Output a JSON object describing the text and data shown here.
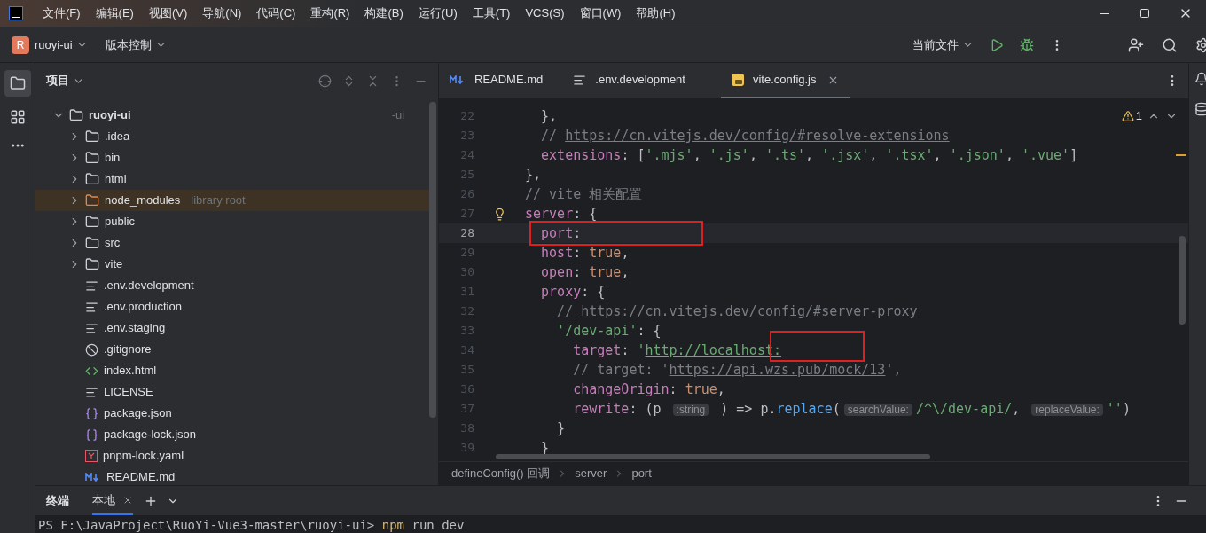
{
  "menu_bar": {
    "items": [
      "文件(F)",
      "编辑(E)",
      "视图(V)",
      "导航(N)",
      "代码(C)",
      "重构(R)",
      "构建(B)",
      "运行(U)",
      "工具(T)",
      "VCS(S)",
      "窗口(W)",
      "帮助(H)"
    ]
  },
  "toolbar": {
    "project_badge": "R",
    "project": "ruoyi-ui",
    "vcs": "版本控制",
    "run_config": "当前文件"
  },
  "project_panel": {
    "title": "项目",
    "tree": [
      {
        "label": "ruoyi-ui",
        "kind": "root",
        "expanded": true,
        "suffix": "-ui",
        "children": [
          {
            "label": ".idea",
            "kind": "folder",
            "expanded": false
          },
          {
            "label": "bin",
            "kind": "folder",
            "expanded": false
          },
          {
            "label": "html",
            "kind": "folder",
            "expanded": false
          },
          {
            "label": "node_modules",
            "kind": "library",
            "expanded": false,
            "hint": "library root",
            "selected": true
          },
          {
            "label": "public",
            "kind": "folder",
            "expanded": false
          },
          {
            "label": "src",
            "kind": "folder",
            "expanded": false
          },
          {
            "label": "vite",
            "kind": "folder",
            "expanded": false
          },
          {
            "label": ".env.development",
            "kind": "text"
          },
          {
            "label": ".env.production",
            "kind": "text"
          },
          {
            "label": ".env.staging",
            "kind": "text"
          },
          {
            "label": ".gitignore",
            "kind": "ignore"
          },
          {
            "label": "index.html",
            "kind": "html"
          },
          {
            "label": "LICENSE",
            "kind": "text"
          },
          {
            "label": "package.json",
            "kind": "json"
          },
          {
            "label": "package-lock.json",
            "kind": "json"
          },
          {
            "label": "pnpm-lock.yaml",
            "kind": "yaml"
          },
          {
            "label": "README.md",
            "kind": "md"
          }
        ]
      }
    ]
  },
  "editor": {
    "tabs": [
      {
        "label": "README.md",
        "kind": "md",
        "selected": false
      },
      {
        "label": ".env.development",
        "kind": "text",
        "selected": false
      },
      {
        "label": "vite.config.js",
        "kind": "js",
        "selected": true
      }
    ],
    "warnings": "1",
    "lines": [
      {
        "n": "22",
        "current": false,
        "bulb": false,
        "tokens": [
          {
            "kind": "p",
            "s": "  },"
          }
        ]
      },
      {
        "n": "23",
        "current": false,
        "bulb": false,
        "tokens": [
          {
            "kind": "c",
            "s": "  // "
          },
          {
            "kind": "cl",
            "s": "https://cn.vitejs.dev/config/#resolve-extensions"
          }
        ]
      },
      {
        "n": "24",
        "current": false,
        "bulb": false,
        "tokens": [
          {
            "kind": "k",
            "s": "  extensions"
          },
          {
            "kind": "p",
            "s": ": ["
          },
          {
            "kind": "s",
            "s": "'.mjs'"
          },
          {
            "kind": "p",
            "s": ", "
          },
          {
            "kind": "s",
            "s": "'.js'"
          },
          {
            "kind": "p",
            "s": ", "
          },
          {
            "kind": "s",
            "s": "'.ts'"
          },
          {
            "kind": "p",
            "s": ", "
          },
          {
            "kind": "s",
            "s": "'.jsx'"
          },
          {
            "kind": "p",
            "s": ", "
          },
          {
            "kind": "s",
            "s": "'.tsx'"
          },
          {
            "kind": "p",
            "s": ", "
          },
          {
            "kind": "s",
            "s": "'.json'"
          },
          {
            "kind": "p",
            "s": ", "
          },
          {
            "kind": "s",
            "s": "'.vue'"
          },
          {
            "kind": "p",
            "s": "]"
          }
        ]
      },
      {
        "n": "25",
        "current": false,
        "bulb": false,
        "tokens": [
          {
            "kind": "p",
            "s": "},"
          }
        ]
      },
      {
        "n": "26",
        "current": false,
        "bulb": false,
        "tokens": [
          {
            "kind": "c",
            "s": "// vite 相关配置"
          }
        ]
      },
      {
        "n": "27",
        "current": false,
        "bulb": true,
        "tokens": [
          {
            "kind": "k",
            "s": "server"
          },
          {
            "kind": "p",
            "s": ": {"
          }
        ]
      },
      {
        "n": "28",
        "current": true,
        "bulb": false,
        "tokens": [
          {
            "kind": "k",
            "s": "  port"
          },
          {
            "kind": "p",
            "s": ": "
          }
        ]
      },
      {
        "n": "29",
        "current": false,
        "bulb": false,
        "tokens": [
          {
            "kind": "k",
            "s": "  host"
          },
          {
            "kind": "p",
            "s": ": "
          },
          {
            "kind": "b",
            "s": "true"
          },
          {
            "kind": "p",
            "s": ","
          }
        ]
      },
      {
        "n": "30",
        "current": false,
        "bulb": false,
        "tokens": [
          {
            "kind": "k",
            "s": "  open"
          },
          {
            "kind": "p",
            "s": ": "
          },
          {
            "kind": "b",
            "s": "true"
          },
          {
            "kind": "p",
            "s": ","
          }
        ]
      },
      {
        "n": "31",
        "current": false,
        "bulb": false,
        "tokens": [
          {
            "kind": "k",
            "s": "  proxy"
          },
          {
            "kind": "p",
            "s": ": {"
          }
        ]
      },
      {
        "n": "32",
        "current": false,
        "bulb": false,
        "tokens": [
          {
            "kind": "c",
            "s": "    // "
          },
          {
            "kind": "cl",
            "s": "https://cn.vitejs.dev/config/#server-proxy"
          }
        ]
      },
      {
        "n": "33",
        "current": false,
        "bulb": false,
        "tokens": [
          {
            "kind": "s",
            "s": "    '/dev-api'"
          },
          {
            "kind": "p",
            "s": ": {"
          }
        ]
      },
      {
        "n": "34",
        "current": false,
        "bulb": false,
        "tokens": [
          {
            "kind": "k",
            "s": "      target"
          },
          {
            "kind": "p",
            "s": ": "
          },
          {
            "kind": "s",
            "s": "'"
          },
          {
            "kind": "sl",
            "s": "http://localhost:"
          }
        ]
      },
      {
        "n": "35",
        "current": false,
        "bulb": false,
        "tokens": [
          {
            "kind": "c",
            "s": "      // target: '"
          },
          {
            "kind": "cl",
            "s": "https://api.wzs.pub/mock/13"
          },
          {
            "kind": "c",
            "s": "',"
          }
        ]
      },
      {
        "n": "36",
        "current": false,
        "bulb": false,
        "tokens": [
          {
            "kind": "k",
            "s": "      changeOrigin"
          },
          {
            "kind": "p",
            "s": ": "
          },
          {
            "kind": "b",
            "s": "true"
          },
          {
            "kind": "p",
            "s": ","
          }
        ]
      },
      {
        "n": "37",
        "current": false,
        "bulb": false,
        "tokens": [
          {
            "kind": "k",
            "s": "      rewrite"
          },
          {
            "kind": "p",
            "s": ": (p "
          },
          {
            "kind": "h",
            "s": ":string"
          },
          {
            "kind": "p",
            "s": " ) => p."
          },
          {
            "kind": "f",
            "s": "replace"
          },
          {
            "kind": "p",
            "s": "("
          },
          {
            "kind": "h",
            "s": "searchValue:"
          },
          {
            "kind": "s",
            "s": "/^\\/dev-api/"
          },
          {
            "kind": "p",
            "s": ", "
          },
          {
            "kind": "h",
            "s": "replaceValue:"
          },
          {
            "kind": "s",
            "s": "''"
          },
          {
            "kind": "p",
            "s": ")"
          }
        ]
      },
      {
        "n": "38",
        "current": false,
        "bulb": false,
        "tokens": [
          {
            "kind": "p",
            "s": "    }"
          }
        ]
      },
      {
        "n": "39",
        "current": false,
        "bulb": false,
        "tokens": [
          {
            "kind": "p",
            "s": "  }"
          }
        ]
      }
    ],
    "breadcrumbs": [
      "defineConfig() 回调",
      "server",
      "port"
    ]
  },
  "terminal": {
    "title": "终端",
    "tabs": [
      {
        "label": "本地",
        "selected": true
      }
    ],
    "prompt": "PS F:\\JavaProject\\RuoYi-Vue3-master\\ruoyi-ui>",
    "command": "npm",
    "args": "run dev"
  }
}
